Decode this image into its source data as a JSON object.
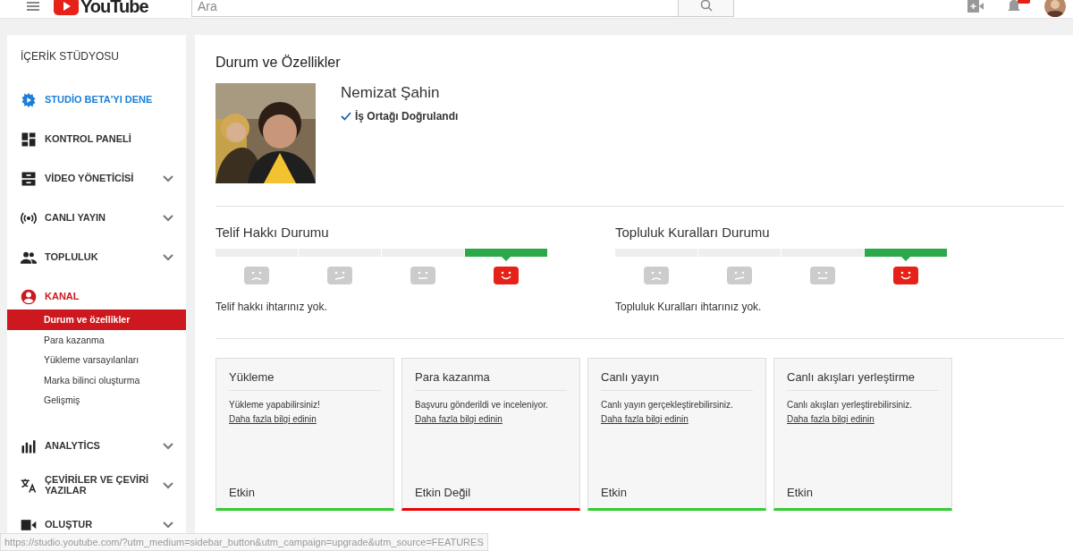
{
  "header": {
    "logo": "YouTube",
    "search": {
      "placeholder": "Ara"
    }
  },
  "sidebar": {
    "title": "İÇERİK STÜDYOSU",
    "items": [
      {
        "kind": "promo",
        "label": "STUDİO BETA'YI DENE"
      },
      {
        "kind": "link",
        "label": "KONTROL PANELİ"
      },
      {
        "kind": "menu",
        "label": "VİDEO YÖNETİCİSİ",
        "expanded": false
      },
      {
        "kind": "menu",
        "label": "CANLI YAYIN",
        "expanded": false
      },
      {
        "kind": "menu",
        "label": "TOPLULUK",
        "expanded": false
      },
      {
        "kind": "menu",
        "label": "KANAL",
        "expanded": true,
        "children": [
          {
            "label": "Durum ve özellikler",
            "selected": true
          },
          {
            "label": "Para kazanma",
            "selected": false
          },
          {
            "label": "Yükleme varsayılanları",
            "selected": false
          },
          {
            "label": "Marka bilinci oluşturma",
            "selected": false
          },
          {
            "label": "Gelişmiş",
            "selected": false
          }
        ]
      },
      {
        "kind": "menu",
        "label": "ANALYTİCS",
        "expanded": false
      },
      {
        "kind": "menu",
        "label": "ÇEVİRİLER VE ÇEVİRİ YAZILAR",
        "expanded": false
      },
      {
        "kind": "menu",
        "label": "OLUŞTUR",
        "expanded": false
      }
    ]
  },
  "main": {
    "title": "Durum ve Özellikler",
    "profile": {
      "name": "Nemizat Şahin",
      "verified": true,
      "verified_label": "İş Ortağı Doğrulandı"
    },
    "strike_panels": [
      {
        "title": "Telif Hakkı Durumu",
        "segments": [
          {
            "kind": "sad",
            "selected": false
          },
          {
            "kind": "meh",
            "selected": false
          },
          {
            "kind": "flat",
            "selected": false
          },
          {
            "kind": "happy",
            "selected": true
          }
        ],
        "message": "Telif hakkı ihtarınız yok."
      },
      {
        "title": "Topluluk Kuralları Durumu",
        "segments": [
          {
            "kind": "sad",
            "selected": false
          },
          {
            "kind": "meh",
            "selected": false
          },
          {
            "kind": "flat",
            "selected": false
          },
          {
            "kind": "happy",
            "selected": true
          }
        ],
        "message": "Topluluk Kuralları ihtarınız yok."
      }
    ],
    "features": [
      {
        "title": "Yükleme",
        "text": "Yükleme yapabilirsiniz! ",
        "link": "Daha fazla bilgi edinin",
        "status": "Etkin",
        "enabled": true
      },
      {
        "title": "Para kazanma",
        "text": "Başvuru gönderildi ve inceleniyor.",
        "link": "Daha fazla bilgi edinin",
        "status": "Etkin Değil",
        "enabled": false
      },
      {
        "title": "Canlı yayın",
        "text": "Canlı yayın gerçekleştirebilirsiniz.",
        "link": "Daha fazla bilgi edinin",
        "status": "Etkin",
        "enabled": true
      },
      {
        "title": "Canlı akışları yerleştirme",
        "text": "Canlı akışları yerleştirebilirsiniz.",
        "link": "Daha fazla bilgi edinin",
        "status": "Etkin",
        "enabled": true
      }
    ]
  },
  "status_bar": {
    "url": "https://studio.youtube.com/?utm_medium=sidebar_button&utm_campaign=upgrade&utm_source=FEATURES"
  }
}
